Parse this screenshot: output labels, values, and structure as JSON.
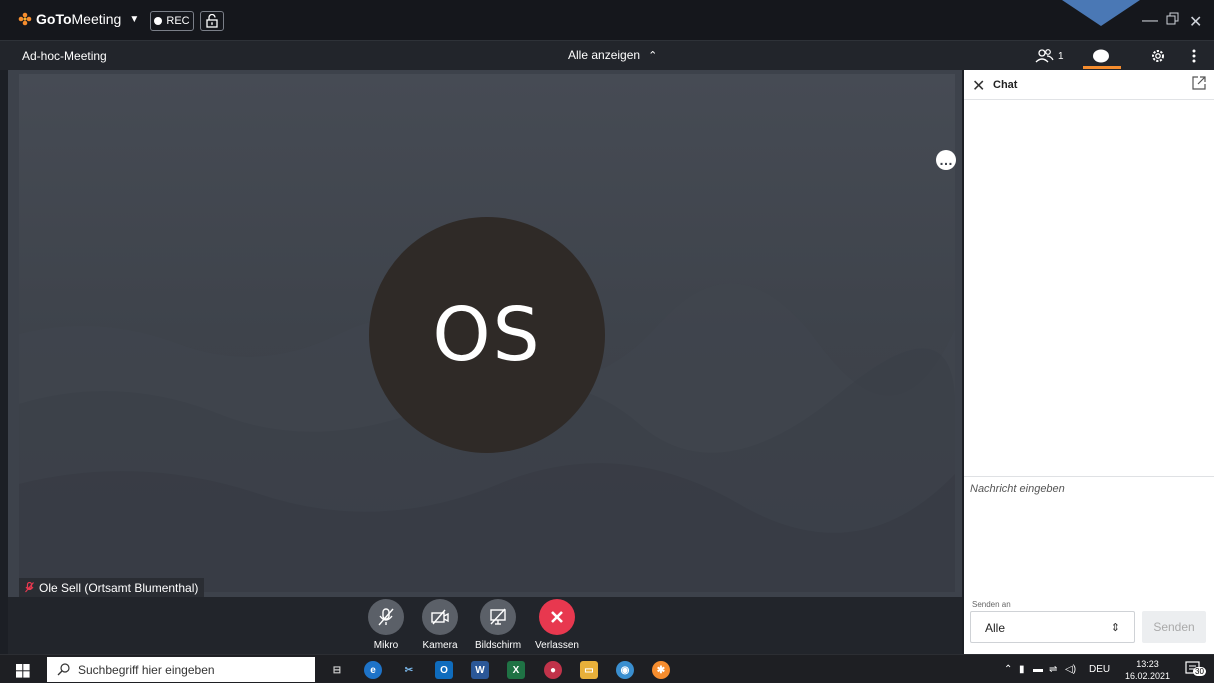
{
  "app": {
    "brand_bold": "GoTo",
    "brand_rest": "Meeting",
    "rec_label": "REC"
  },
  "subbar": {
    "meeting_name": "Ad-hoc-Meeting",
    "view_select": "Alle anzeigen",
    "participants_count": "1"
  },
  "video": {
    "avatar_initials": "OS",
    "participant_name": "Ole Sell (Ortsamt Blumenthal)",
    "more_label": "…"
  },
  "controls": {
    "mic_label": "Mikro",
    "camera_label": "Kamera",
    "screen_label": "Bildschirm",
    "leave_label": "Verlassen"
  },
  "chat": {
    "title": "Chat",
    "input_placeholder": "Nachricht eingeben",
    "send_to_label": "Senden an",
    "send_to_value": "Alle",
    "send_button": "Senden"
  },
  "taskbar": {
    "search_placeholder": "Suchbegriff hier eingeben",
    "language": "DEU",
    "time": "13:23",
    "date": "16.02.2021",
    "notification_count": "30"
  },
  "colors": {
    "accent_orange": "#f68d2e",
    "leave_red": "#e8384f",
    "indicator_blue": "#4a78b5"
  }
}
